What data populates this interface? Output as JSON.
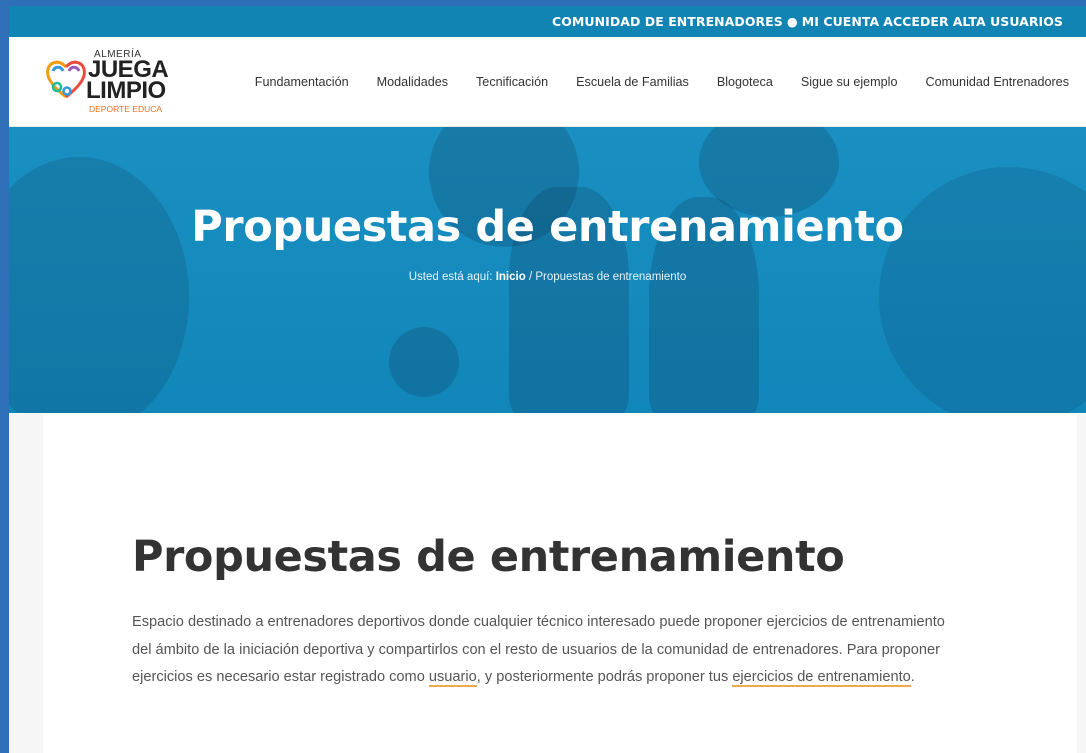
{
  "topbar": {
    "comunidad": "COMUNIDAD DE ENTRENADORES",
    "separator": "●",
    "mi_cuenta": "MI CUENTA",
    "acceder": "ACCEDER",
    "alta": "ALTA USUARIOS"
  },
  "logo": {
    "almeria": "ALMERÍA",
    "juega": "JUEGA",
    "limpio": "LIMPIO",
    "tagline": "DEPORTE EDUCA"
  },
  "nav": {
    "items": [
      {
        "label": "Fundamentación"
      },
      {
        "label": "Modalidades"
      },
      {
        "label": "Tecnificación"
      },
      {
        "label": "Escuela de Familias"
      },
      {
        "label": "Blogoteca"
      },
      {
        "label": "Sigue su ejemplo"
      },
      {
        "label": "Comunidad Entrenadores"
      }
    ]
  },
  "hero": {
    "title": "Propuestas de entrenamiento",
    "breadcrumb_prefix": "Usted está aquí:",
    "breadcrumb_home": "Inicio",
    "breadcrumb_sep": "/",
    "breadcrumb_current": "Propuestas de entrenamiento"
  },
  "content": {
    "title": "Propuestas de entrenamiento",
    "text_part1": "Espacio destinado a entrenadores deportivos donde cualquier técnico interesado puede proponer ejercicios de entrenamiento del ámbito de la iniciación deportiva y compartirlos con el resto de usuarios de la comunidad de entrenadores. Para proponer ejercicios es necesario estar registrado como",
    "link_usuario": "usuario",
    "text_part2": ", y posteriormente podrás proponer tus",
    "link_ejercicios": "ejercicios de entrenamiento",
    "text_part3": "."
  },
  "colors": {
    "topbar": "#1184b3",
    "hero": "#1a8fc1",
    "link_underline": "#f0a94a",
    "frame_border": "#2f6fb8"
  }
}
